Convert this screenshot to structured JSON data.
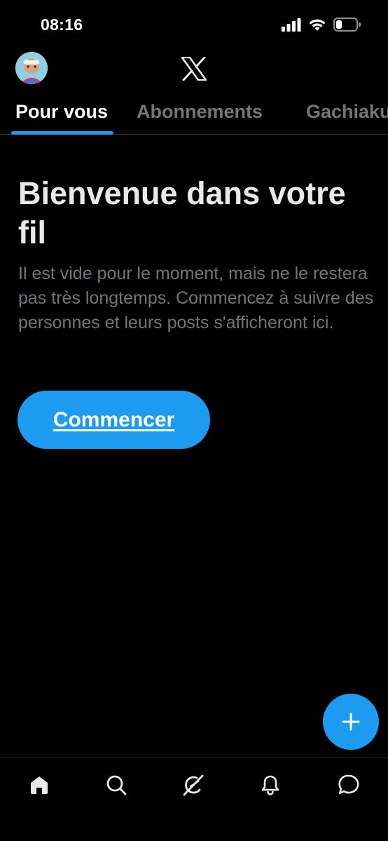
{
  "status_bar": {
    "time": "08:16",
    "signal_icon": "cellular-signal-icon",
    "wifi_icon": "wifi-icon",
    "battery_icon": "battery-low-icon"
  },
  "header": {
    "avatar": "profile-avatar",
    "logo_icon": "x-logo-icon"
  },
  "tabs": [
    {
      "label": "Pour vous",
      "active": true
    },
    {
      "label": "Abonnements",
      "active": false
    },
    {
      "label": "Gachiaku",
      "active": false
    }
  ],
  "welcome": {
    "title": "Bienvenue dans votre fil",
    "description": "Il est vide pour le moment, mais ne le restera pas très longtemps. Commencez à suivre des personnes et leurs posts s'afficheront ici.",
    "button_label": "Commencer"
  },
  "fab": {
    "icon": "plus-icon"
  },
  "bottom_nav": [
    {
      "icon": "home-icon",
      "active": true
    },
    {
      "icon": "search-icon",
      "active": false
    },
    {
      "icon": "grok-icon",
      "active": false
    },
    {
      "icon": "bell-icon",
      "active": false
    },
    {
      "icon": "message-icon",
      "active": false
    }
  ],
  "colors": {
    "accent": "#1d9bf0",
    "background": "#000000",
    "text_primary": "#e7e9ea",
    "text_secondary": "#71767b",
    "divider": "#2f3336"
  }
}
